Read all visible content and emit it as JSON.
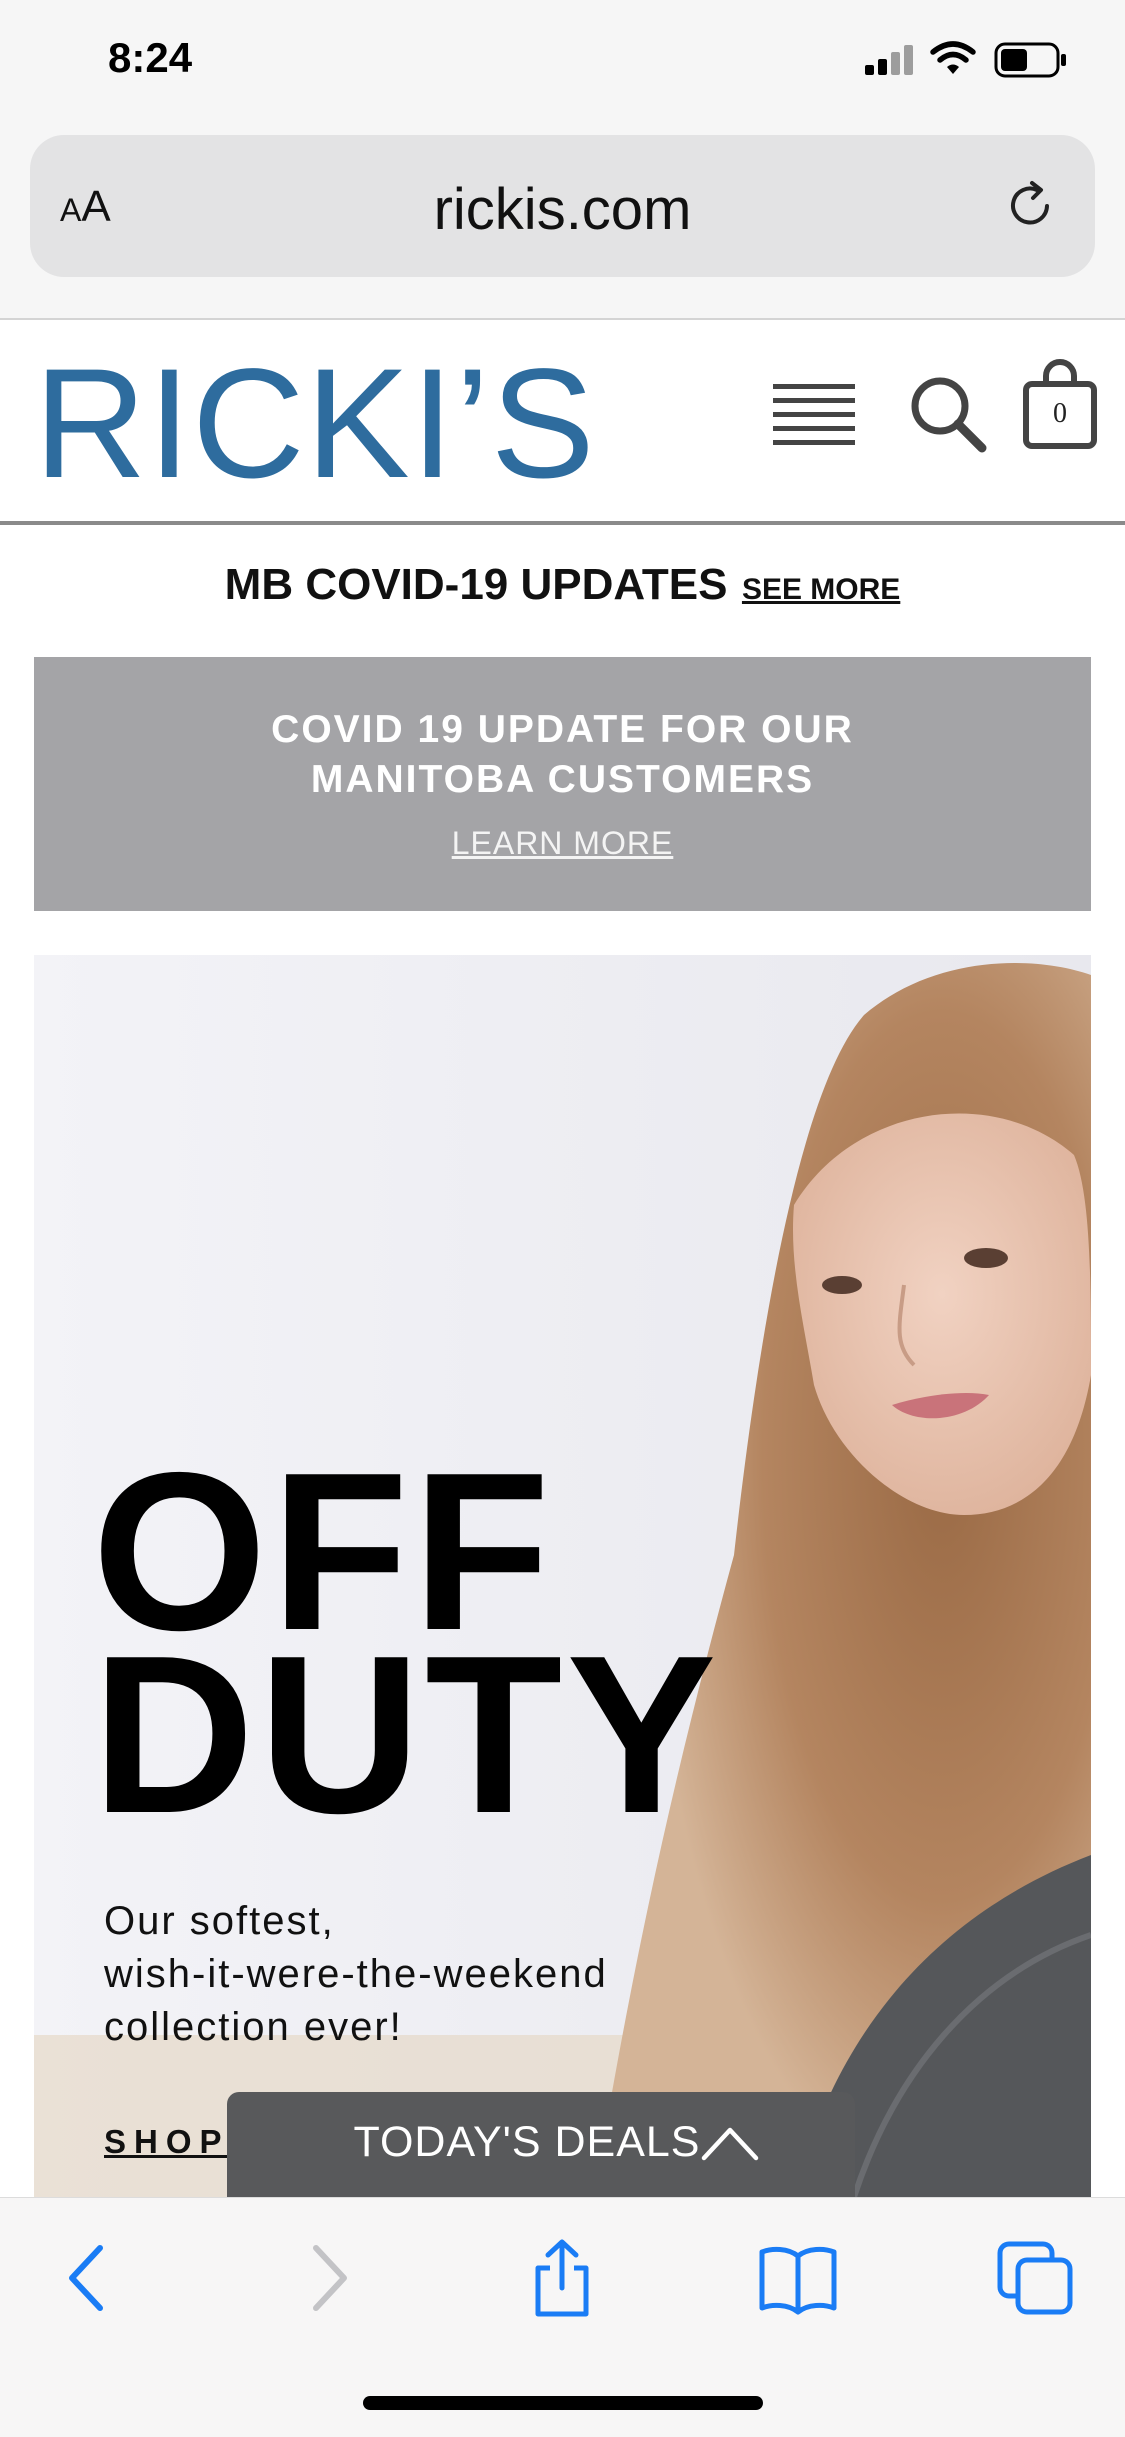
{
  "status_bar": {
    "time": "8:24"
  },
  "browser": {
    "aa_label_small": "A",
    "aa_label_large": "A",
    "url": "rickis.com"
  },
  "header": {
    "logo": "RICKI’S",
    "cart_count": "0"
  },
  "notice": {
    "title": "MB COVID-19 UPDATES",
    "link": "SEE MORE"
  },
  "banner": {
    "title_line1": "COVID 19 UPDATE FOR OUR",
    "title_line2": "MANITOBA CUSTOMERS",
    "link": "LEARN MORE"
  },
  "hero": {
    "headline_line1": "OFF",
    "headline_line2": "DUTY",
    "sub_line1": "Our softest,",
    "sub_line2": "wish-it-were-the-weekend",
    "sub_line3": "collection ever!",
    "cta": "SHOP"
  },
  "deals": {
    "label": "TODAY'S DEALS"
  },
  "colors": {
    "brand": "#2e6c9e",
    "banner_bg": "#a4a4a7",
    "deals_bg": "#58595b",
    "safari_blue": "#1a7cf5"
  },
  "icons": [
    "signal-icon",
    "wifi-icon",
    "battery-icon",
    "reload-icon",
    "menu-icon",
    "search-icon",
    "bag-icon",
    "chevron-up-icon",
    "back-icon",
    "forward-icon",
    "share-icon",
    "bookmarks-icon",
    "tabs-icon"
  ]
}
